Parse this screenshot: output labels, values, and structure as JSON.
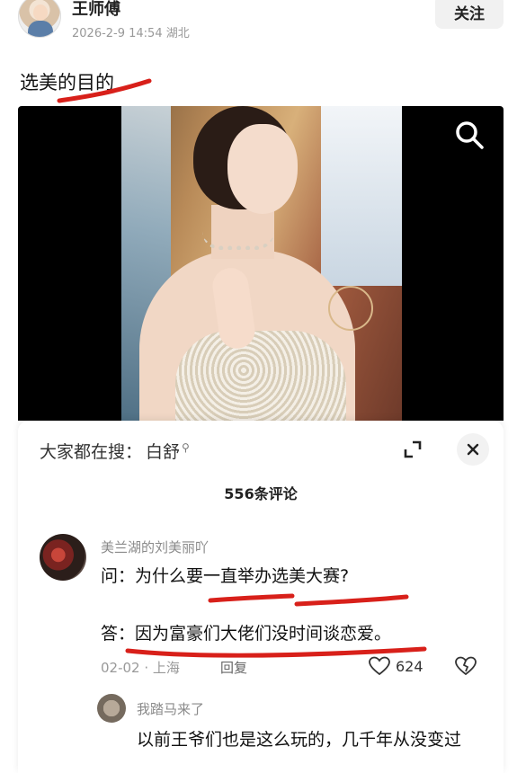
{
  "header": {
    "author": "王师傅",
    "meta": "2026-2-9 14:54 湖北",
    "follow_label": "关注"
  },
  "post": {
    "title": "选美的目的"
  },
  "photo": {
    "zoom_icon": "search-icon"
  },
  "comments_panel": {
    "search_hint_prefix": "大家都在搜：",
    "search_term": "白舒",
    "comment_count": "556条评论",
    "comments": [
      {
        "user": "美兰湖的刘美丽吖",
        "question": "问：为什么要一直举办选美大赛?",
        "answer": "答：因为富豪们大佬们没时间谈恋爱。",
        "date_location": "02-02 · 上海",
        "reply_label": "回复",
        "likes": "624"
      }
    ],
    "reply": {
      "user": "我踏马来了",
      "text": "以前王爷们也是这么玩的，几千年从没变过"
    }
  },
  "colors": {
    "annotation_red": "#d8201a",
    "follow_bg": "#f1f1f1",
    "muted_text": "#999999"
  }
}
